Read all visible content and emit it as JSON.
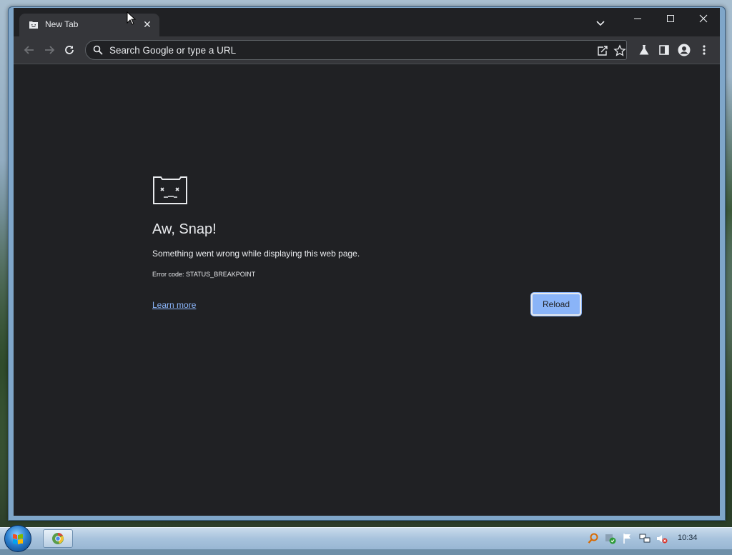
{
  "tab": {
    "title": "New Tab",
    "close": "✕"
  },
  "omnibox": {
    "placeholder": "Search Google or type a URL"
  },
  "error": {
    "title": "Aw, Snap!",
    "message": "Something went wrong while displaying this web page.",
    "code": "Error code: STATUS_BREAKPOINT",
    "learn_more": "Learn more",
    "reload": "Reload"
  },
  "taskbar": {
    "clock": "10:34"
  },
  "colors": {
    "page_bg": "#202124",
    "toolbar_bg": "#35363a",
    "accent": "#8ab4f8",
    "text": "#e8eaed"
  },
  "icons": {
    "toolbar": [
      "back-arrow-icon",
      "forward-arrow-icon",
      "reload-icon"
    ],
    "omnibox": [
      "search-icon",
      "share-icon",
      "star-icon"
    ],
    "right": [
      "labs-flask-icon",
      "side-panel-icon",
      "profile-icon",
      "more-menu-icon"
    ],
    "window": [
      "minimize-icon",
      "maximize-icon",
      "close-icon"
    ],
    "tray": [
      "search-tray-icon",
      "security-icon",
      "flag-icon",
      "network-icon",
      "volume-muted-icon"
    ]
  }
}
